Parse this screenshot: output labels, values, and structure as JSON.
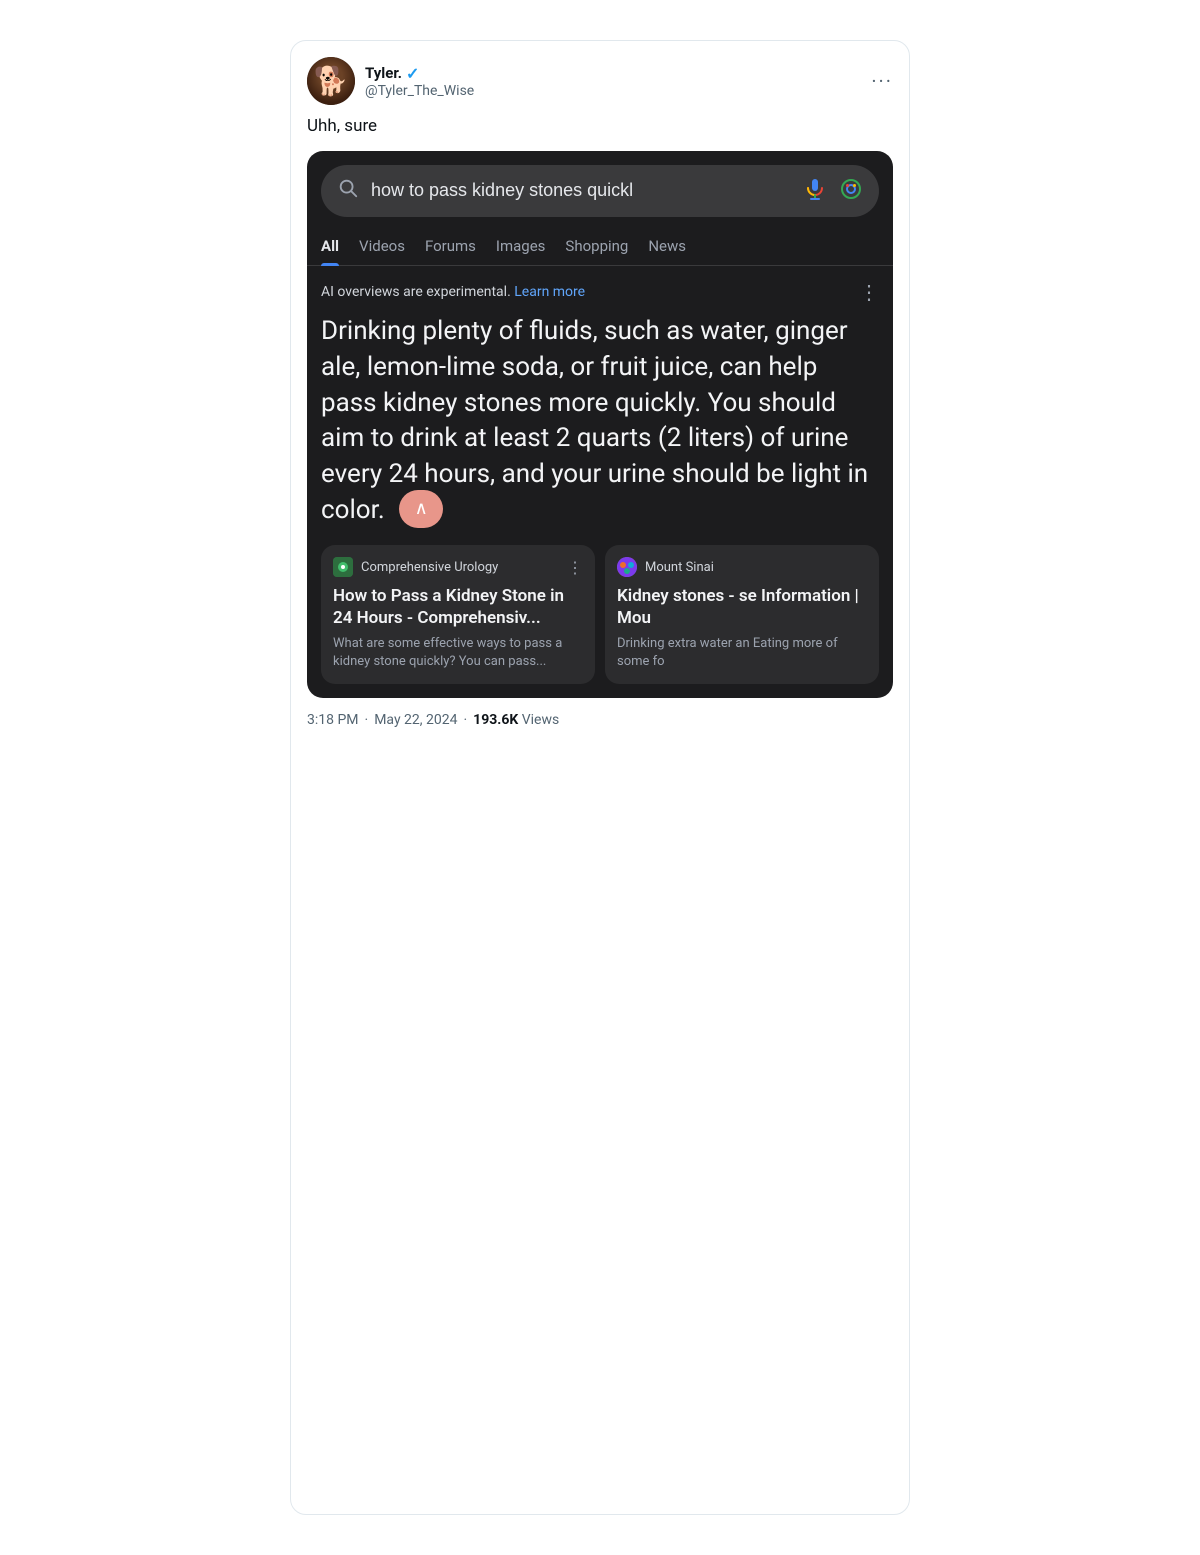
{
  "tweet": {
    "user": {
      "display_name": "Tyler.",
      "username": "@Tyler_The_Wise",
      "verified": true
    },
    "text": "Uhh, sure",
    "time": "3:18 PM",
    "date": "May 22, 2024",
    "views": "193.6K",
    "views_label": "Views"
  },
  "google": {
    "search_query": "how to pass kidney stones quickl",
    "tabs": [
      "All",
      "Videos",
      "Forums",
      "Images",
      "Shopping",
      "News"
    ],
    "active_tab": "All",
    "ai_notice": "AI overviews are experimental.",
    "learn_more": "Learn more",
    "ai_answer": "Drinking plenty of fluids, such as water, ginger ale, lemon-lime soda, or fruit juice, can help pass kidney stones more quickly. You should aim to drink at least 2 quarts (2 liters) of urine every 24 hours, and your urine should be light in color.",
    "sources": [
      {
        "name": "Comprehensive Urology",
        "title": "How to Pass a Kidney Stone in 24 Hours - Comprehensiv...",
        "desc": "What are some effective ways to pass a kidney stone quickly? You can pass..."
      },
      {
        "name": "Mount Sinai",
        "title": "Kidney stones - se Information | Mou",
        "desc": "Drinking extra water an Eating more of some fo"
      }
    ]
  },
  "icons": {
    "more_options": "···",
    "search": "🔍",
    "collapse_arrow": "∧",
    "three_dots_vertical": "⋮"
  }
}
